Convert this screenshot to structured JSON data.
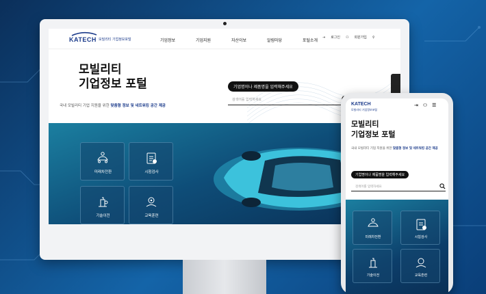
{
  "site": {
    "brand": "KATECH",
    "brand_sub": "모빌리티 기업정보포털",
    "nav": [
      "기업정보",
      "기업지원",
      "자산이보",
      "알림마당",
      "포털소개"
    ],
    "util": {
      "login": "로그인",
      "signup": "회원가입"
    },
    "hero": {
      "title_line1": "모빌리티",
      "title_line2": "기업정보 포털",
      "desc_prefix": "국내 모빌리티 기업 지원을 위한 ",
      "desc_bold": "맞춤형 정보 및 네트워킹 공간 제공",
      "pill": "기업명이나 제품명을 입력해주세요",
      "search_placeholder": "검색어를 입력하세요"
    },
    "tiles": [
      "미래차전환",
      "시험검사",
      "기술이전",
      "교육훈련"
    ]
  },
  "mobile": {
    "brand": "KATECH",
    "brand_sub": "모빌리티 기업정보포털",
    "title_line1": "모빌리티",
    "title_line2": "기업정보 포털",
    "desc_prefix": "국내 모빌리티 기업 지원을 위한 ",
    "desc_bold": "맞춤형 정보 및 네트워킹 공간 제공",
    "pill": "기업명이나 제품명을 입력해주세요",
    "search_placeholder": "검색어를 입력하세요",
    "tiles": [
      "미래차전환",
      "시험검사",
      "기술이전",
      "교육훈련"
    ]
  },
  "colors": {
    "brand": "#1a3a8a",
    "bg": "#1464a8",
    "panel": "#0e4d78"
  }
}
